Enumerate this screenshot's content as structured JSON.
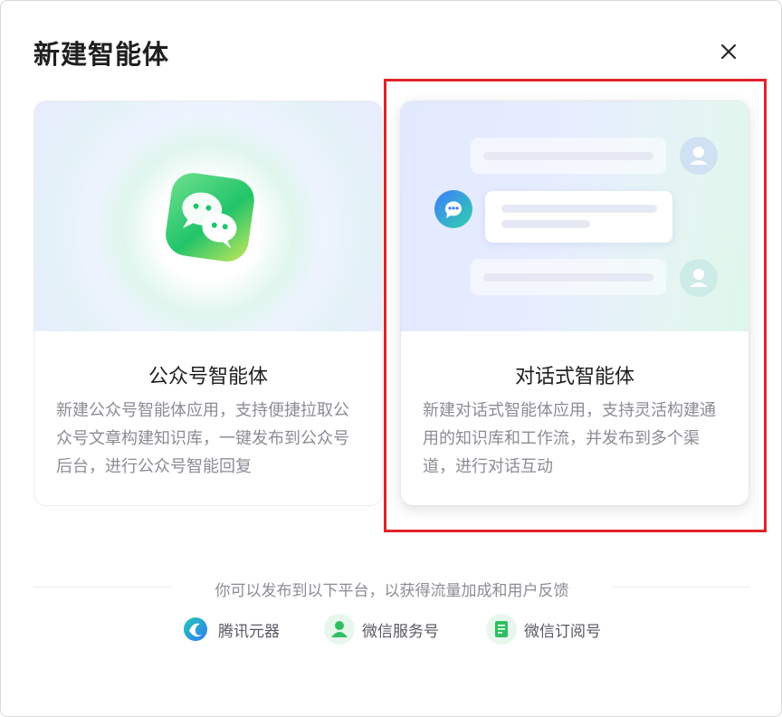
{
  "dialog": {
    "title": "新建智能体"
  },
  "cards": [
    {
      "title": "公众号智能体",
      "description": "新建公众号智能体应用，支持便捷拉取公众号文章构建知识库，一键发布到公众号后台，进行公众号智能回复"
    },
    {
      "title": "对话式智能体",
      "description": "新建对话式智能体应用，支持灵活构建通用的知识库和工作流，并发布到多个渠道，进行对话互动"
    }
  ],
  "footer": {
    "note": "你可以发布到以下平台，以获得流量加成和用户反馈",
    "platforms": [
      {
        "label": "腾讯元器",
        "icon": "yuanqi-icon"
      },
      {
        "label": "微信服务号",
        "icon": "service-account-icon"
      },
      {
        "label": "微信订阅号",
        "icon": "subscription-account-icon"
      }
    ]
  },
  "colors": {
    "highlight": "#e0232b",
    "wechat_green": "#2fcf6a"
  }
}
